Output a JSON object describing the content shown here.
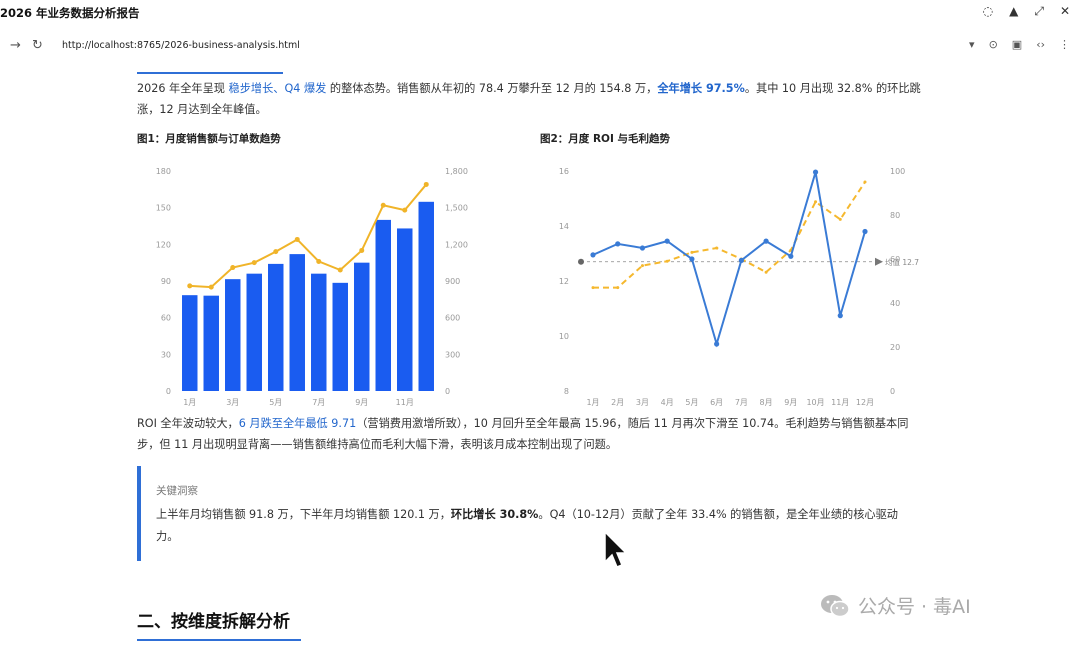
{
  "window": {
    "title": "2026 年业务数据分析报告"
  },
  "browser": {
    "url": "http://localhost:8765/2026-business-analysis.html"
  },
  "intro": {
    "p1": "2026 年全年呈现 ",
    "h1": "稳步增长、Q4 爆发",
    "p2": " 的整体态势。销售额从年初的 78.4 万攀升至 12 月的 154.8 万，",
    "h2": "全年增长 97.5%",
    "p3": "。其中 10 月出现 32.8% 的环比跳涨，12 月达到全年峰值。"
  },
  "figure1": {
    "title": "图1：月度销售额与订单数趋势"
  },
  "figure2": {
    "title": "图2：月度 ROI 与毛利趋势"
  },
  "analysis": {
    "p1": "ROI 全年波动较大，",
    "h1": "6 月跌至全年最低 9.71",
    "p2": "（营销费用激增所致），10 月回升至全年最高 15.96，随后 11 月再次下滑至 10.74。毛利趋势与销售额基本同步，但 11 月出现明显背离——销售额维持高位而毛利大幅下滑，表明该月成本控制出现了问题。"
  },
  "insight": {
    "label": "关键洞察",
    "p1": "上半年月均销售额 91.8 万，下半年月均销售额 120.1 万，",
    "b1": "环比增长 30.8%",
    "p2": "。Q4（10-12月）贡献了全年 33.4% 的销售额，是全年业绩的核心驱动力。"
  },
  "section": {
    "title": "二、按维度拆解分析"
  },
  "watermark": {
    "text": "公众号 · 毒AI"
  },
  "colors": {
    "accent": "#2f6fd6",
    "bar": "#1a5cf0",
    "orders": "#f0b429",
    "roi": "#3a7bd5",
    "margin": "#f5b82e"
  },
  "chart_data": [
    {
      "type": "bar",
      "categories": [
        "1月",
        "2月",
        "3月",
        "4月",
        "5月",
        "6月",
        "7月",
        "8月",
        "9月",
        "10月",
        "11月",
        "12月"
      ],
      "x_tick_labels": [
        "1月",
        "",
        "3月",
        "",
        "5月",
        "",
        "7月",
        "",
        "9月",
        "",
        "11月",
        ""
      ],
      "series": [
        {
          "type": "bar",
          "axis": "left",
          "values": [
            78.4,
            78,
            91.5,
            96,
            104,
            112,
            96,
            88.5,
            105,
            140,
            133,
            154.8
          ]
        },
        {
          "type": "line",
          "axis": "right",
          "values": [
            860,
            850,
            1010,
            1050,
            1140,
            1240,
            1060,
            990,
            1150,
            1520,
            1480,
            1690
          ]
        }
      ],
      "y_left": {
        "ylim": [
          0,
          180
        ],
        "ticks": [
          0,
          30,
          60,
          90,
          120,
          150,
          180
        ]
      },
      "y_right": {
        "ylim": [
          0,
          1800
        ],
        "ticks": [
          0,
          300,
          600,
          900,
          1200,
          1500,
          1800
        ]
      },
      "grid": false
    },
    {
      "type": "line",
      "categories": [
        "1月",
        "2月",
        "3月",
        "4月",
        "5月",
        "6月",
        "7月",
        "8月",
        "9月",
        "10月",
        "11月",
        "12月"
      ],
      "series": [
        {
          "axis": "left",
          "values": [
            12.95,
            13.35,
            13.2,
            13.45,
            12.8,
            9.71,
            12.75,
            13.45,
            12.9,
            15.96,
            10.74,
            13.8
          ]
        },
        {
          "axis": "right",
          "dashed": true,
          "values": [
            47,
            47,
            57,
            59,
            63,
            65,
            60,
            54,
            64,
            86,
            78,
            95
          ]
        }
      ],
      "y_left": {
        "ylim": [
          8,
          16
        ],
        "ticks": [
          8,
          10,
          12,
          14,
          16
        ]
      },
      "y_right": {
        "ylim": [
          0,
          100
        ],
        "ticks": [
          0,
          20,
          40,
          60,
          80,
          100
        ]
      },
      "reference_line": {
        "value": 12.7,
        "label": "均值 12.7"
      },
      "grid": false
    }
  ]
}
